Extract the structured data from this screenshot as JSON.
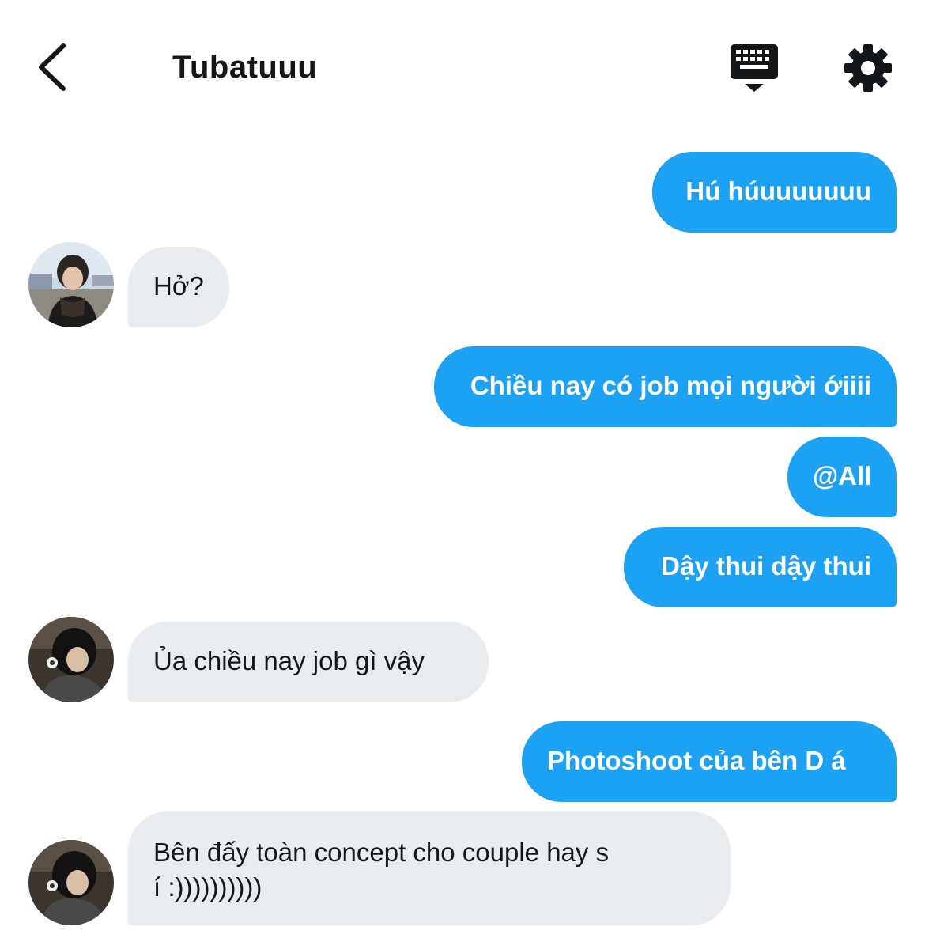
{
  "header": {
    "title": "Tubatuuu",
    "back_icon": "chevron-left-icon",
    "keyboard_icon": "keyboard-icon",
    "settings_icon": "gear-icon"
  },
  "colors": {
    "outgoing_bubble": "#1da1f2",
    "incoming_bubble": "#e6ecf0",
    "text_dark": "#14171a"
  },
  "messages": [
    {
      "direction": "out",
      "text": "Hú húuuuuuuu"
    },
    {
      "direction": "in",
      "text": "Hở?"
    },
    {
      "direction": "out",
      "text": "Chiều nay có job mọi người ớiiii"
    },
    {
      "direction": "out",
      "text": "@All"
    },
    {
      "direction": "out",
      "text": "Dậy thui dậy thui"
    },
    {
      "direction": "in",
      "text": "Ủa chiều nay job gì vậy"
    },
    {
      "direction": "out",
      "text": "Photoshoot của bên D á"
    },
    {
      "direction": "in",
      "line1": "Bên đấy toàn concept cho couple hay s",
      "line2": "í :))))))))))"
    }
  ]
}
